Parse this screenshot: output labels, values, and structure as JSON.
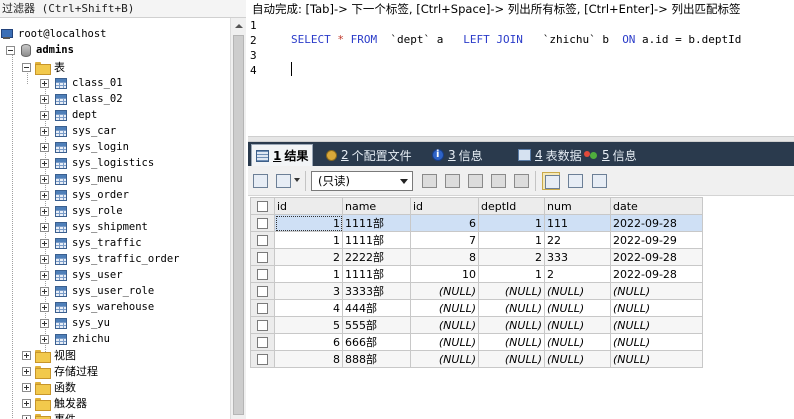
{
  "filter": {
    "label": "过滤器 (Ctrl+Shift+B)"
  },
  "tree": {
    "server": "root@localhost",
    "database": "admins",
    "tables_folder": "表",
    "tables": [
      "class_01",
      "class_02",
      "dept",
      "sys_car",
      "sys_login",
      "sys_logistics",
      "sys_menu",
      "sys_order",
      "sys_role",
      "sys_shipment",
      "sys_traffic",
      "sys_traffic_order",
      "sys_user",
      "sys_user_role",
      "sys_warehouse",
      "sys_yu",
      "zhichu"
    ],
    "other_folders": [
      "视图",
      "存储过程",
      "函数",
      "触发器",
      "事件"
    ]
  },
  "editor": {
    "hint": "自动完成: [Tab]-> 下一个标签, [Ctrl+Space]-> 列出所有标签, [Ctrl+Enter]-> 列出匹配标签",
    "line_numbers": [
      "1",
      "2",
      "3",
      "4"
    ],
    "sql": {
      "select": "SELECT",
      "star": " * ",
      "from": "FROM",
      "table1": "  `dept` a  ",
      "join": " LEFT JOIN ",
      "table2": "  `zhichu` b  ",
      "on": "ON",
      "cond": " a.id = b.deptId"
    }
  },
  "tabs": [
    {
      "num": "1",
      "label": "结果"
    },
    {
      "num": "2",
      "label": "个配置文件"
    },
    {
      "num": "3",
      "label": "信息"
    },
    {
      "num": "4",
      "label": "表数据"
    },
    {
      "num": "5",
      "label": "信息"
    }
  ],
  "toolbar": {
    "mode_select": "(只读)"
  },
  "grid": {
    "columns": [
      "id",
      "name",
      "id",
      "deptId",
      "num",
      "date"
    ],
    "rows": [
      [
        "1",
        "1111部",
        "6",
        "1",
        "111",
        "2022-09-28"
      ],
      [
        "1",
        "1111部",
        "7",
        "1",
        "22",
        "2022-09-29"
      ],
      [
        "2",
        "2222部",
        "8",
        "2",
        "333",
        "2022-09-28"
      ],
      [
        "1",
        "1111部",
        "10",
        "1",
        "2",
        "2022-09-28"
      ],
      [
        "3",
        "3333部",
        "(NULL)",
        "(NULL)",
        "(NULL)",
        "(NULL)"
      ],
      [
        "4",
        "444部",
        "(NULL)",
        "(NULL)",
        "(NULL)",
        "(NULL)"
      ],
      [
        "5",
        "555部",
        "(NULL)",
        "(NULL)",
        "(NULL)",
        "(NULL)"
      ],
      [
        "6",
        "666部",
        "(NULL)",
        "(NULL)",
        "(NULL)",
        "(NULL)"
      ],
      [
        "8",
        "888部",
        "(NULL)",
        "(NULL)",
        "(NULL)",
        "(NULL)"
      ]
    ]
  }
}
